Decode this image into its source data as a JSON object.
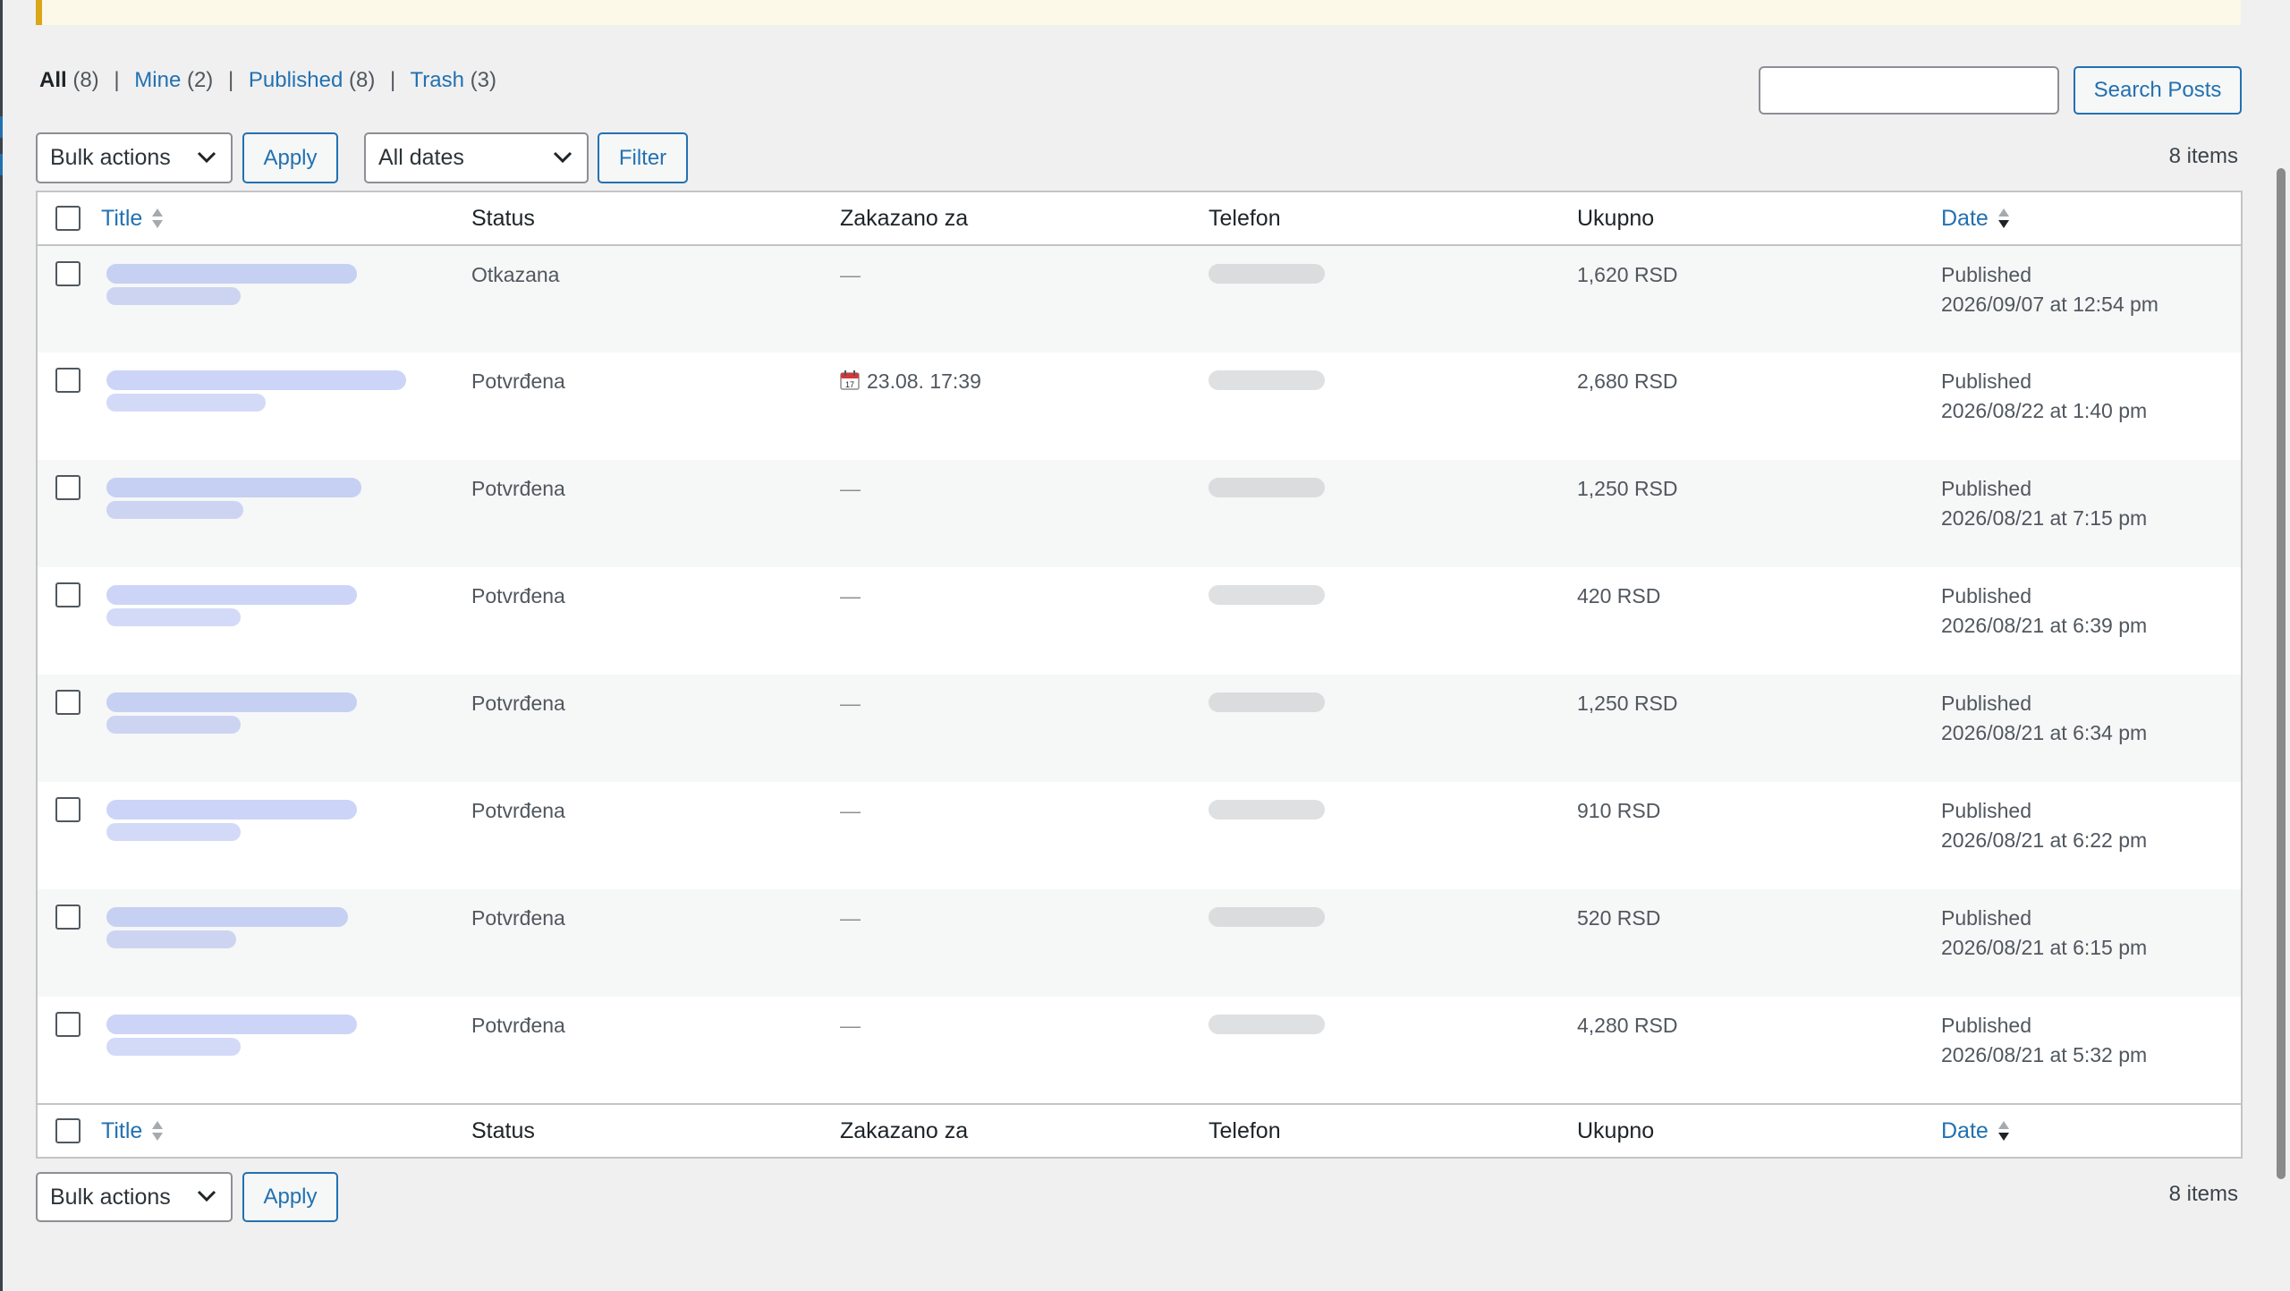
{
  "views": [
    {
      "label": "All",
      "count": "(8)",
      "current": true
    },
    {
      "label": "Mine",
      "count": "(2)",
      "current": false
    },
    {
      "label": "Published",
      "count": "(8)",
      "current": false
    },
    {
      "label": "Trash",
      "count": "(3)",
      "current": false
    }
  ],
  "search": {
    "value": "",
    "button": "Search Posts"
  },
  "top_nav": {
    "bulk_select": "Bulk actions",
    "apply": "Apply",
    "dates_select": "All dates",
    "filter": "Filter",
    "items_count": "8 items"
  },
  "bottom_nav": {
    "bulk_select": "Bulk actions",
    "apply": "Apply",
    "items_count": "8 items"
  },
  "columns": {
    "title": "Title",
    "status": "Status",
    "scheduled": "Zakazano za",
    "phone": "Telefon",
    "total": "Ukupno",
    "date": "Date"
  },
  "rows": [
    {
      "status": "Otkazana",
      "scheduled": "—",
      "scheduled_icon": false,
      "total": "1,620 RSD",
      "date_status": "Published",
      "date": "2026/09/07 at 12:54 pm"
    },
    {
      "status": "Potvrđena",
      "scheduled": "23.08. 17:39",
      "scheduled_icon": "calendar-icon",
      "total": "2,680 RSD",
      "date_status": "Published",
      "date": "2026/08/22 at 1:40 pm"
    },
    {
      "status": "Potvrđena",
      "scheduled": "—",
      "scheduled_icon": false,
      "total": "1,250 RSD",
      "date_status": "Published",
      "date": "2026/08/21 at 7:15 pm"
    },
    {
      "status": "Potvrđena",
      "scheduled": "—",
      "scheduled_icon": false,
      "total": "420 RSD",
      "date_status": "Published",
      "date": "2026/08/21 at 6:39 pm"
    },
    {
      "status": "Potvrđena",
      "scheduled": "—",
      "scheduled_icon": false,
      "total": "1,250 RSD",
      "date_status": "Published",
      "date": "2026/08/21 at 6:34 pm"
    },
    {
      "status": "Potvrđena",
      "scheduled": "—",
      "scheduled_icon": false,
      "total": "910 RSD",
      "date_status": "Published",
      "date": "2026/08/21 at 6:22 pm"
    },
    {
      "status": "Potvrđena",
      "scheduled": "—",
      "scheduled_icon": false,
      "total": "520 RSD",
      "date_status": "Published",
      "date": "2026/08/21 at 6:15 pm"
    },
    {
      "status": "Potvrđena",
      "scheduled": "—",
      "scheduled_icon": false,
      "total": "4,280 RSD",
      "date_status": "Published",
      "date": "2026/08/21 at 5:32 pm"
    }
  ],
  "colors": {
    "link": "#2271b1",
    "notice_border": "#dba617",
    "notice_bg": "#fcf9e8",
    "page_bg": "#f0f0f1",
    "row_alt": "#f6f7f7"
  }
}
